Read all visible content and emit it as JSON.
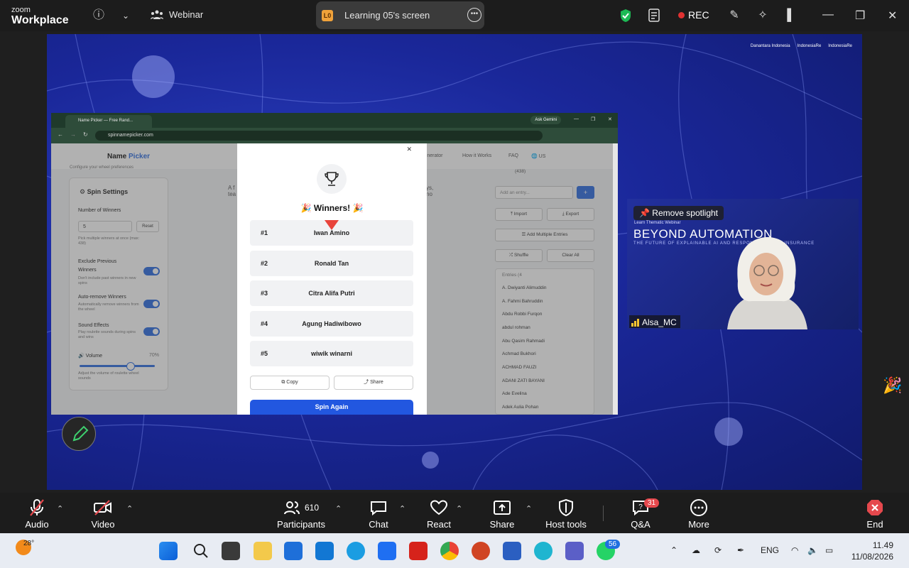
{
  "zoom": {
    "logo_line1": "zoom",
    "logo_line2": "Workplace",
    "meeting_type": "Webinar",
    "share_label": "Learning 05's screen",
    "share_avatar": "L0",
    "rec_label": "REC"
  },
  "browser": {
    "tab_title": "Name Picker — Free Rand...",
    "ask_gemini": "Ask Gemini",
    "url": "spinnamepicker.com"
  },
  "page": {
    "title_a": "Name ",
    "title_b": "Picker",
    "nav": [
      "Generator",
      "How it Works",
      "FAQ",
      "US"
    ],
    "sidebar_caption": "Configure your wheel preferences",
    "spin_settings": "Spin Settings",
    "number_of_winners": "Number of Winners",
    "winners_value": "5",
    "reset": "Reset",
    "pick_help": "Pick multiple winners at once (max: 438)",
    "exclude_prev": "Exclude Previous Winners",
    "exclude_help": "Don't include past winners in new spins",
    "auto_remove": "Auto-remove Winners",
    "auto_help": "Automatically remove winners from the wheel",
    "sound_effects": "Sound Effects",
    "sound_help": "Play roulette sounds during spins and wins",
    "volume": "Volume",
    "volume_value": "70%",
    "volume_help": "Adjust the volume of roulette wheel sounds",
    "mid_text_1": "A f",
    "mid_text_2": "tea",
    "mid_text_3": "ys,",
    "mid_text_4": "no",
    "right_count": "(438)",
    "add_entry_placeholder": "Add an entry...",
    "import": "Import",
    "export": "Export",
    "add_multiple": "Add Multiple Entries",
    "shuffle": "Shuffle",
    "clear_all": "Clear All",
    "entries_label": "Entries (4",
    "entries": [
      "A. Dwiyanti Alimuddin",
      "A. Fahmi Bahruddin",
      "Abdu Robbi Furqon",
      "abdul rohman",
      "Abu Qasim Rahmadi",
      "Achmad Bukhori",
      "ACHMAD FAUZI",
      "ADANI ZATI BAYANI",
      "Ade Evelina",
      "Adek Aulia Pohan"
    ]
  },
  "modal": {
    "title": "🎉 Winners! 🎉",
    "winners": [
      {
        "rank": "#1",
        "name": "Iwan Amino"
      },
      {
        "rank": "#2",
        "name": "Ronald Tan"
      },
      {
        "rank": "#3",
        "name": "Citra Alifa Putri"
      },
      {
        "rank": "#4",
        "name": "Agung Hadiwibowo"
      },
      {
        "rank": "#5",
        "name": "wiwik winarni"
      }
    ],
    "copy": "Copy",
    "share": "Share",
    "spin_again": "Spin Again"
  },
  "speaker": {
    "remove_spotlight": "Remove spotlight",
    "banner_small": "Learn Thematic Webinar",
    "banner_title": "BEYOND AUTOMATION",
    "banner_sub": "THE FUTURE OF EXPLAINABLE AI AND RESPONSIBLE AI IN INSURANCE",
    "name": "Alsa_MC"
  },
  "brand_logos": [
    "Danantara Indonesia",
    "IndonesiaRe",
    "IndonesiaRe"
  ],
  "controls": {
    "audio": "Audio",
    "video": "Video",
    "participants": "Participants",
    "participants_count": "610",
    "chat": "Chat",
    "react": "React",
    "share": "Share",
    "host_tools": "Host tools",
    "qa": "Q&A",
    "qa_badge": "31",
    "more": "More",
    "end": "End"
  },
  "taskbar": {
    "temperature": "28°",
    "whatsapp_badge": "56",
    "lang": "ENG",
    "time": "11.49",
    "date": "11/08/2026"
  },
  "colors": {
    "zoom_bar": "#1c1c1c",
    "accent_blue": "#2257e0",
    "rec_red": "#e03131",
    "shield_green": "#1db954",
    "end_red": "#e5484d"
  }
}
